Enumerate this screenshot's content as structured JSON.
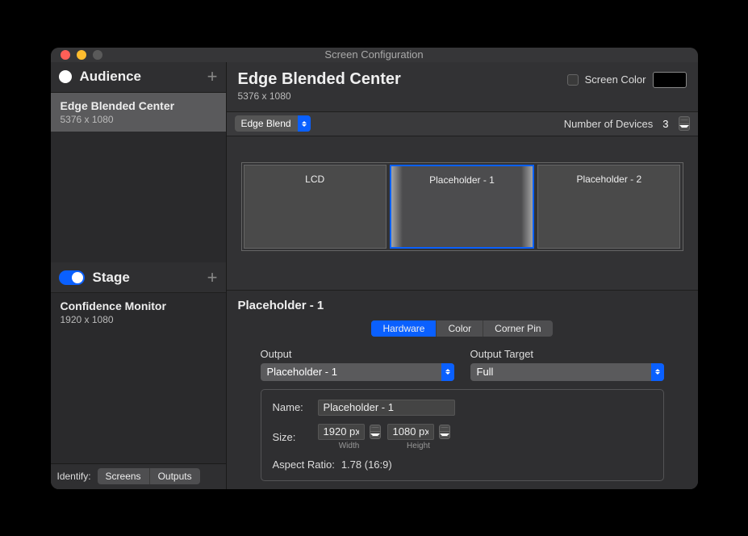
{
  "window": {
    "title": "Screen Configuration"
  },
  "colors": {
    "close": "#ff5f57",
    "min": "#febc2e",
    "max": "#5a5a5a"
  },
  "sidebar": {
    "audience_label": "Audience",
    "stage_label": "Stage",
    "audience_items": [
      {
        "name": "Edge Blended Center",
        "dim": "5376 x 1080",
        "selected": true
      }
    ],
    "stage_items": [
      {
        "name": "Confidence Monitor",
        "dim": "1920 x 1080"
      }
    ],
    "identify_label": "Identify:",
    "identify_buttons": [
      "Screens",
      "Outputs"
    ]
  },
  "header": {
    "title": "Edge Blended Center",
    "sub": "5376 x 1080",
    "screen_color_label": "Screen Color"
  },
  "toolbar": {
    "mode": "Edge Blend",
    "num_devices_label": "Number of Devices",
    "num_devices_value": "3"
  },
  "displays": [
    {
      "label": "LCD"
    },
    {
      "label": "Placeholder - 1",
      "selected": true,
      "blend": true
    },
    {
      "label": "Placeholder - 2"
    }
  ],
  "props": {
    "title": "Placeholder - 1",
    "tabs": [
      "Hardware",
      "Color",
      "Corner Pin"
    ],
    "active_tab": "Hardware",
    "output_label": "Output",
    "output_value": "Placeholder - 1",
    "output_target_label": "Output Target",
    "output_target_value": "Full",
    "name_label": "Name:",
    "name_value": "Placeholder - 1",
    "size_label": "Size:",
    "width_value": "1920 px",
    "height_value": "1080 px",
    "width_caption": "Width",
    "height_caption": "Height",
    "aspect_label": "Aspect Ratio:",
    "aspect_value": "1.78 (16:9)"
  }
}
